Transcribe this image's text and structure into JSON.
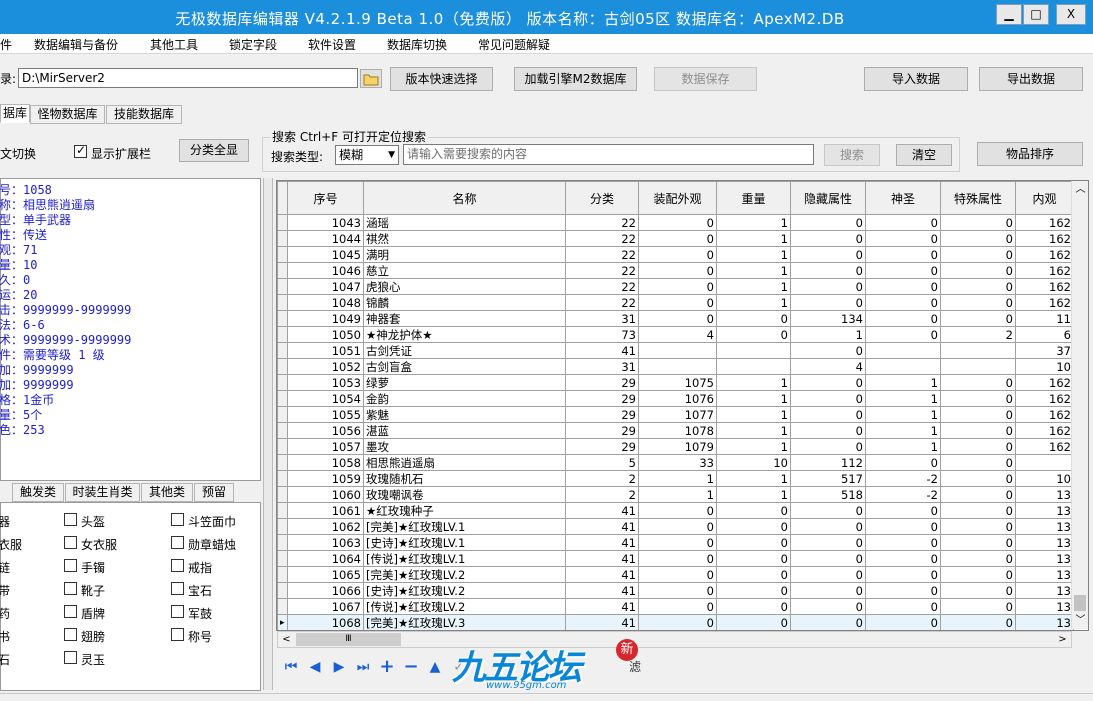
{
  "window": {
    "title": "无极数据库编辑器 V4.2.1.9    Beta 1.0（免费版）    版本名称：古剑05区      数据库名：ApexM2.DB",
    "min": "▁",
    "max": "□",
    "close": "X"
  },
  "menu": [
    "件",
    "数据编辑与备份",
    "其他工具",
    "锁定字段",
    "软件设置",
    "数据库切换",
    "常见问题解疑"
  ],
  "toolbar": {
    "path_label": "录:",
    "path_value": "D:\\MirServer2",
    "version_select": "版本快速选择",
    "load_db": "加载引擎M2数据库",
    "save_data": "数据保存",
    "import": "导入数据",
    "export": "导出数据"
  },
  "tabs": [
    "据库",
    "怪物数据库",
    "技能数据库"
  ],
  "controls": {
    "lang_switch": "文切换",
    "show_ext": "显示扩展栏",
    "show_all": "分类全显",
    "search_title": "搜索  Ctrl+F 可打开定位搜索",
    "search_type_label": "搜索类型:",
    "search_type": "模糊",
    "search_placeholder": "请输入需要搜索的内容",
    "search_btn": "搜索",
    "clear_btn": "清空",
    "sort_btn": "物品排序"
  },
  "info_lines": [
    "号：1058",
    "称：相思熊逍遥扇",
    "型：单手武器",
    "性：传送",
    "观：71",
    "量：10",
    "久：0",
    "运：20",
    "击：9999999-9999999",
    "法：6-6",
    "术：9999999-9999999",
    "件：需要等级 1 级",
    "加：9999999",
    "加：9999999",
    "格：1金币",
    "量：5个",
    "色：253"
  ],
  "cat_tabs": [
    "触发类",
    "时装生肖类",
    "其他类",
    "预留"
  ],
  "categories": [
    [
      "器",
      "头盔",
      "斗笠面巾"
    ],
    [
      "衣服",
      "女衣服",
      "勋章蜡烛"
    ],
    [
      "链",
      "手镯",
      "戒指"
    ],
    [
      "带",
      "靴子",
      "宝石"
    ],
    [
      "药",
      "盾牌",
      "军鼓"
    ],
    [
      "书",
      "翅膀",
      "称号"
    ],
    [
      "石",
      "灵玉",
      ""
    ]
  ],
  "columns": [
    "序号",
    "名称",
    "分类",
    "装配外观",
    "重量",
    "隐藏属性",
    "神圣",
    "特殊属性",
    "内观"
  ],
  "rows": [
    [
      "1043",
      "涵瑶",
      "22",
      "0",
      "1",
      "0",
      "0",
      "0",
      "162"
    ],
    [
      "1044",
      "祺然",
      "22",
      "0",
      "1",
      "0",
      "0",
      "0",
      "162"
    ],
    [
      "1045",
      "满明",
      "22",
      "0",
      "1",
      "0",
      "0",
      "0",
      "162"
    ],
    [
      "1046",
      "慈立",
      "22",
      "0",
      "1",
      "0",
      "0",
      "0",
      "162"
    ],
    [
      "1047",
      "虎狼心",
      "22",
      "0",
      "1",
      "0",
      "0",
      "0",
      "162"
    ],
    [
      "1048",
      "锦麟",
      "22",
      "0",
      "1",
      "0",
      "0",
      "0",
      "162"
    ],
    [
      "1049",
      "神器套",
      "31",
      "0",
      "0",
      "134",
      "0",
      "0",
      "11"
    ],
    [
      "1050",
      "★神龙护体★",
      "73",
      "4",
      "0",
      "1",
      "0",
      "2",
      "6"
    ],
    [
      "1051",
      "古剑凭证",
      "41",
      "",
      "",
      "0",
      "",
      "",
      "37"
    ],
    [
      "1052",
      "古剑盲盒",
      "31",
      "",
      "",
      "4",
      "",
      "",
      "10"
    ],
    [
      "1053",
      "绿萝",
      "29",
      "1075",
      "1",
      "0",
      "1",
      "0",
      "162"
    ],
    [
      "1054",
      "金韵",
      "29",
      "1076",
      "1",
      "0",
      "1",
      "0",
      "162"
    ],
    [
      "1055",
      "紫魅",
      "29",
      "1077",
      "1",
      "0",
      "1",
      "0",
      "162"
    ],
    [
      "1056",
      "湛蓝",
      "29",
      "1078",
      "1",
      "0",
      "1",
      "0",
      "162"
    ],
    [
      "1057",
      "墨攻",
      "29",
      "1079",
      "1",
      "0",
      "1",
      "0",
      "162"
    ],
    [
      "1058",
      "相思熊逍遥扇",
      "5",
      "33",
      "10",
      "112",
      "0",
      "0",
      ""
    ],
    [
      "1059",
      "玫瑰随机石",
      "2",
      "1",
      "1",
      "517",
      "-2",
      "0",
      "10"
    ],
    [
      "1060",
      "玫瑰嘲讽卷",
      "2",
      "1",
      "1",
      "518",
      "-2",
      "0",
      "13"
    ],
    [
      "1061",
      "★红玫瑰种子",
      "41",
      "0",
      "0",
      "0",
      "0",
      "0",
      "13"
    ],
    [
      "1062",
      "[完美]★红玫瑰LV.1",
      "41",
      "0",
      "0",
      "0",
      "0",
      "0",
      "13"
    ],
    [
      "1063",
      "[史诗]★红玫瑰LV.1",
      "41",
      "0",
      "0",
      "0",
      "0",
      "0",
      "13"
    ],
    [
      "1064",
      "[传说]★红玫瑰LV.1",
      "41",
      "0",
      "0",
      "0",
      "0",
      "0",
      "13"
    ],
    [
      "1065",
      "[完美]★红玫瑰LV.2",
      "41",
      "0",
      "0",
      "0",
      "0",
      "0",
      "13"
    ],
    [
      "1066",
      "[史诗]★红玫瑰LV.2",
      "41",
      "0",
      "0",
      "0",
      "0",
      "0",
      "13"
    ],
    [
      "1067",
      "[传说]★红玫瑰LV.2",
      "41",
      "0",
      "0",
      "0",
      "0",
      "0",
      "13"
    ],
    [
      "1068",
      "[完美]★红玫瑰LV.3",
      "41",
      "0",
      "0",
      "0",
      "0",
      "0",
      "13"
    ]
  ],
  "nav": {
    "first": "⏮",
    "prev": "◀",
    "next": "▶",
    "last": "⏭",
    "add": "+",
    "del": "−",
    "up": "▲",
    "filter": "滤"
  },
  "logo": {
    "main": "九五论坛",
    "url": "www.95gm.com",
    "badge": "新"
  },
  "scroll_thumb": "Ⅲ"
}
